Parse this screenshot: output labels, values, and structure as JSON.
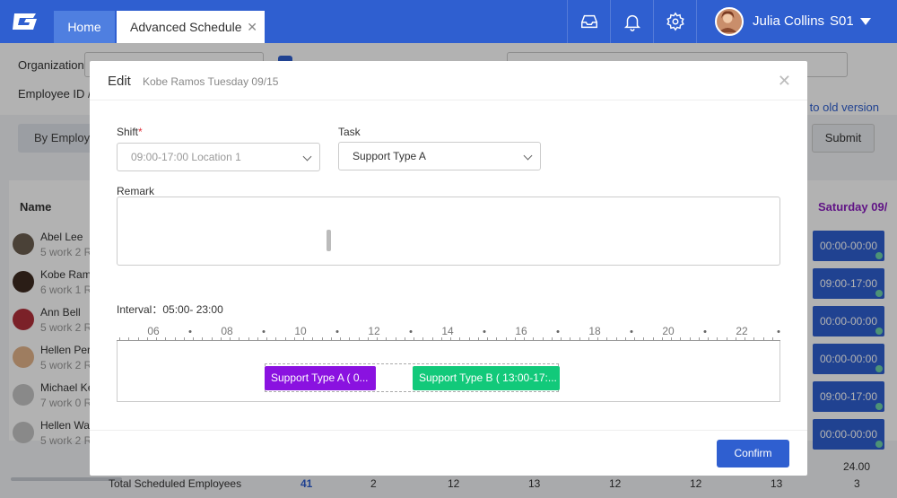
{
  "topbar": {
    "tabs": [
      {
        "label": "Home"
      },
      {
        "label": "Advanced Schedule"
      }
    ],
    "tab_close": "✕",
    "user": {
      "name": "Julia Collins",
      "site": "S01"
    }
  },
  "filters": {
    "organization_label": "Organization",
    "employee_label": "Employee ID / N",
    "old_version_link": "h to old version",
    "by_employee_button": "By Employe",
    "submit_button": "Submit"
  },
  "table": {
    "name_header": "Name",
    "saturday_header": "Saturday 09/",
    "employees": [
      {
        "name": "Abel Lee",
        "sub": "5 work 2 R"
      },
      {
        "name": "Kobe Ram",
        "sub": "6 work 1 R"
      },
      {
        "name": "Ann Bell",
        "sub": "5 work 2 R"
      },
      {
        "name": "Hellen Per",
        "sub": "5 work 2 R"
      },
      {
        "name": "Michael Ke",
        "sub": "7 work 0 R"
      },
      {
        "name": "Hellen Wat",
        "sub": "5 work 2 R"
      }
    ],
    "saturday_cells": [
      "00:00-00:00",
      "09:00-17:00",
      "00:00-00:00",
      "00:00-00:00",
      "09:00-17:00",
      "00:00-00:00"
    ],
    "totals": {
      "label": "Total Scheduled Employees",
      "top_value": "24.00",
      "values": [
        "41",
        "2",
        "12",
        "13",
        "12",
        "12",
        "13",
        "3"
      ]
    }
  },
  "modal": {
    "title": "Edit",
    "subtitle": "Kobe Ramos Tuesday 09/15",
    "close": "✕",
    "shift_label": "Shift",
    "required_mark": "*",
    "shift_value": "09:00-17:00 Location 1",
    "task_label": "Task",
    "task_value": "Support Type A",
    "remark_label": "Remark",
    "interval_text": "Interval：05:00- 23:00",
    "hour_labels": [
      "06",
      "08",
      "10",
      "12",
      "14",
      "16",
      "18",
      "20",
      "22"
    ],
    "task_blocks": [
      {
        "label": "Support Type A ( 0...",
        "color": "#8a12e0"
      },
      {
        "label": "Support Type B ( 13:00-17:...",
        "color": "#12c97a"
      }
    ],
    "confirm_button": "Confirm"
  }
}
